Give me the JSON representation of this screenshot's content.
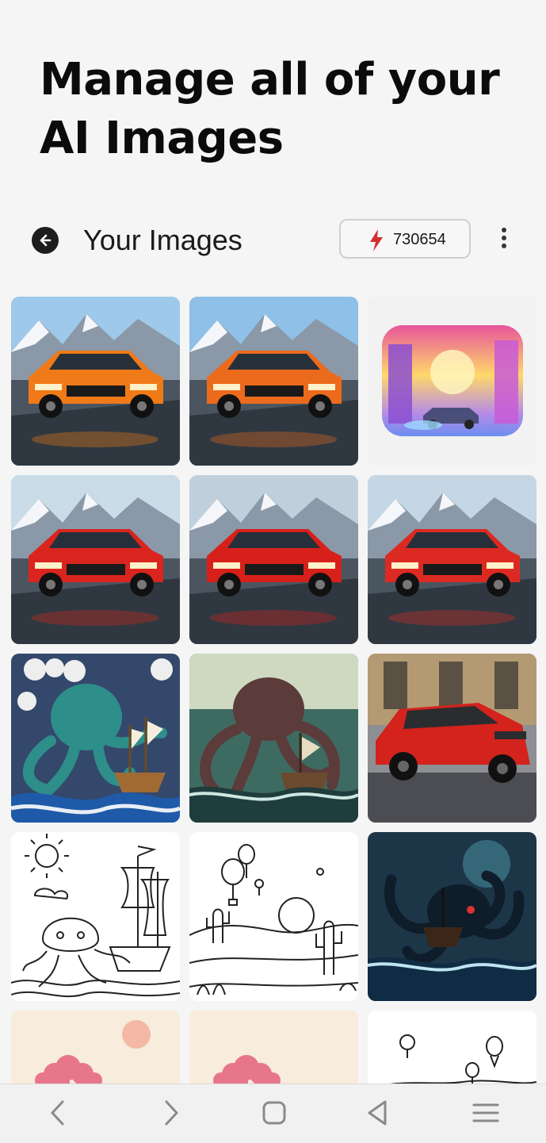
{
  "headline": {
    "line1": "Manage all of your",
    "line2": "AI Images"
  },
  "toolbar": {
    "back_icon": "arrow-left-icon",
    "title": "Your Images",
    "credits_icon": "lightning-bolt-icon",
    "credits": "730654",
    "more_icon": "vertical-dots-icon"
  },
  "gallery": [
    {
      "kind": "car",
      "color": "#f07a18",
      "sky": "#9ec9ea"
    },
    {
      "kind": "car",
      "color": "#ec6a1c",
      "sky": "#8ec0e8"
    },
    {
      "kind": "neon-city"
    },
    {
      "kind": "car",
      "color": "#d9251e",
      "sky": "#c9dce8"
    },
    {
      "kind": "car",
      "color": "#d8201a",
      "sky": "#bfd0dc"
    },
    {
      "kind": "car",
      "color": "#dc2a22",
      "sky": "#c5d6e4"
    },
    {
      "kind": "clay-octopus"
    },
    {
      "kind": "pixel-octopus"
    },
    {
      "kind": "street-car",
      "color": "#d4221c"
    },
    {
      "kind": "sketch-octopus"
    },
    {
      "kind": "sketch-desert"
    },
    {
      "kind": "dark-octopus"
    },
    {
      "kind": "blossom"
    },
    {
      "kind": "blossom"
    },
    {
      "kind": "sketch-balloons"
    }
  ],
  "colors": {
    "accent": "#d32f2f",
    "background": "#f5f5f5",
    "text": "#0b0b0b"
  },
  "nav": {
    "icons": [
      "back-arrow-icon",
      "forward-arrow-icon",
      "home-square-icon",
      "recents-triangle-icon",
      "menu-icon"
    ]
  }
}
